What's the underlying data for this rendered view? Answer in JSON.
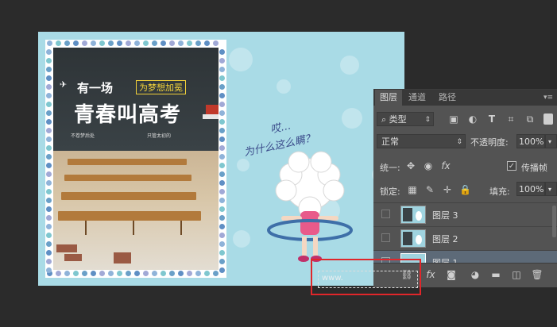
{
  "poster": {
    "line1": "有一场",
    "badge": "为梦想加冕",
    "title": "青春叫高考",
    "slogan_left": "不卷梦后处",
    "slogan_right": "只管太初的"
  },
  "cartoon": {
    "speech_line1": "哎…",
    "speech_line2": "为什么这么瞒？"
  },
  "panel": {
    "tabs": [
      "图层",
      "通道",
      "路径"
    ],
    "filter_kind": "类型",
    "blend_mode": "正常",
    "opacity_label": "不透明度:",
    "opacity_value": "100%",
    "unify_label": "统一:",
    "propagate_label": "传播帧",
    "lock_label": "锁定:",
    "fill_label": "填充:",
    "fill_value": "100%",
    "layers": [
      {
        "name": "图层 3"
      },
      {
        "name": "图层 2"
      },
      {
        "name": "图层 1"
      }
    ]
  },
  "watermark_text": "www.",
  "colors": {
    "highlight": "#e0262a",
    "panel_bg": "#535353",
    "canvas_bg": "#a9dbe6"
  }
}
